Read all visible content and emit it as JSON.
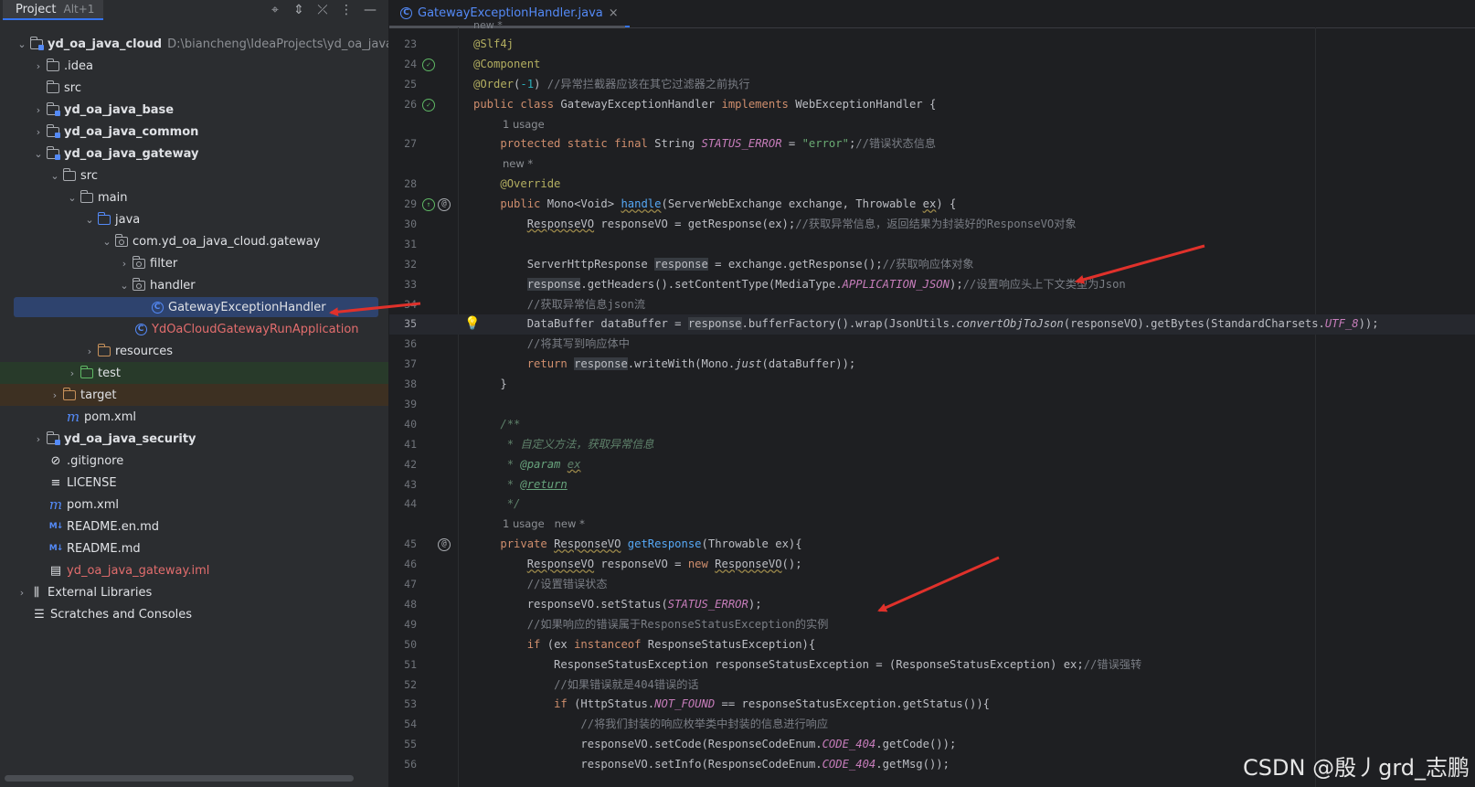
{
  "project_panel": {
    "title": "Project",
    "shortcut": "Alt+1",
    "tools": [
      "locate-icon",
      "expand-collapse-icon",
      "collapse-all-icon",
      "more-icon",
      "minimize-icon"
    ],
    "tree": [
      {
        "label": "yd_oa_java_cloud",
        "path": "D:\\biancheng\\IdeaProjects\\yd_oa_java_clo"
      },
      {
        "label": ".idea"
      },
      {
        "label": "src"
      },
      {
        "label": "yd_oa_java_base"
      },
      {
        "label": "yd_oa_java_common"
      },
      {
        "label": "yd_oa_java_gateway"
      },
      {
        "label": "src"
      },
      {
        "label": "main"
      },
      {
        "label": "java"
      },
      {
        "label": "com.yd_oa_java_cloud.gateway"
      },
      {
        "label": "filter"
      },
      {
        "label": "handler"
      },
      {
        "label": "GatewayExceptionHandler"
      },
      {
        "label": "YdOaCloudGatewayRunApplication"
      },
      {
        "label": "resources"
      },
      {
        "label": "test"
      },
      {
        "label": "target"
      },
      {
        "label": "pom.xml"
      },
      {
        "label": "yd_oa_java_security"
      },
      {
        "label": ".gitignore"
      },
      {
        "label": "LICENSE"
      },
      {
        "label": "pom.xml"
      },
      {
        "label": "README.en.md"
      },
      {
        "label": "README.md"
      },
      {
        "label": "yd_oa_java_gateway.iml"
      },
      {
        "label": "External Libraries"
      },
      {
        "label": "Scratches and Consoles"
      }
    ]
  },
  "editor": {
    "tab_label": "GatewayExceptionHandler.java",
    "close": "×",
    "top_hint": "new *",
    "hints": {
      "h1": "1 usage",
      "h2": "new *",
      "h3": "1 usage   new *"
    },
    "line_numbers": [
      "23",
      "24",
      "25",
      "26",
      "27",
      "28",
      "29",
      "30",
      "31",
      "32",
      "33",
      "34",
      "35",
      "36",
      "37",
      "38",
      "39",
      "40",
      "41",
      "42",
      "43",
      "44",
      "45",
      "46",
      "47",
      "48",
      "49",
      "50",
      "51",
      "52",
      "53",
      "54",
      "55",
      "56"
    ]
  },
  "watermark": "CSDN @殷丿grd_志鹏",
  "colors": {
    "accent": "#3574f0",
    "selection": "#2e436e",
    "annotation_arrow": "#e0312b"
  }
}
